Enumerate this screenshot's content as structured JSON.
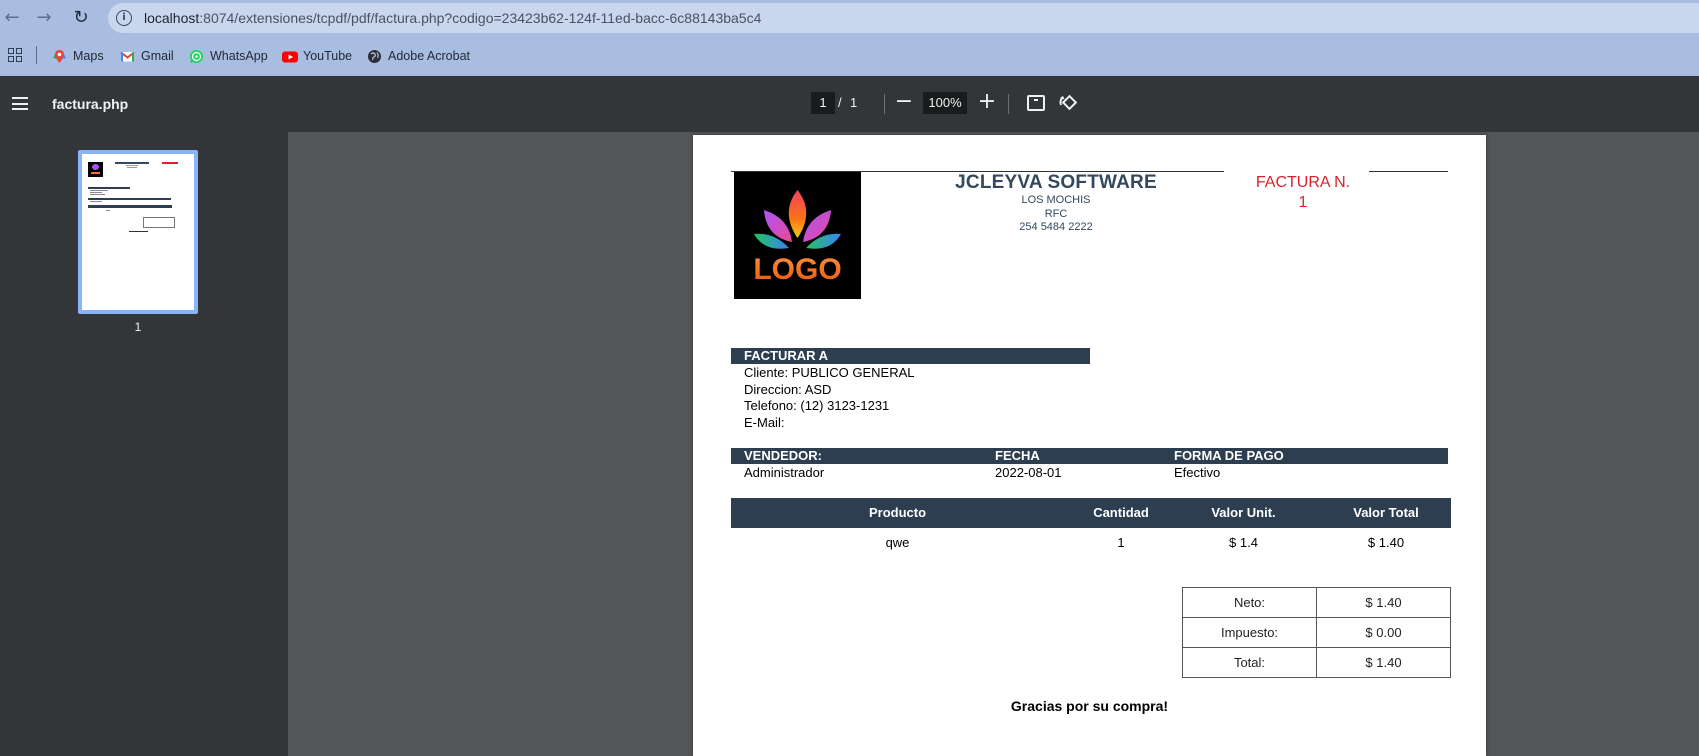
{
  "browser": {
    "url_host": "localhost",
    "url_path": ":8074/extensiones/tcpdf/pdf/factura.php?codigo=23423b62-124f-11ed-bacc-6c88143ba5c4",
    "bookmarks": [
      {
        "label": "Maps"
      },
      {
        "label": "Gmail"
      },
      {
        "label": "WhatsApp"
      },
      {
        "label": "YouTube"
      },
      {
        "label": "Adobe Acrobat"
      }
    ]
  },
  "viewer": {
    "title": "factura.php",
    "current_page": "1",
    "page_separator": "/",
    "total_pages": "1",
    "zoom": "100%",
    "thumbnail_label": "1"
  },
  "invoice": {
    "logo_text": "LOGO",
    "company_name": "JCLEYVA SOFTWARE",
    "company_city": "LOS MOCHIS",
    "company_rfc": "RFC",
    "company_phone": "254 5484 2222",
    "invoice_label": "FACTURA N.",
    "invoice_number": "1",
    "bill_to": {
      "header": "FACTURAR A",
      "client": "Cliente: PUBLICO GENERAL",
      "address": "Direccion: ASD",
      "phone": "Telefono: (12) 3123-1231",
      "email": "E-Mail:"
    },
    "sale": {
      "seller_header": "VENDEDOR:",
      "date_header": "FECHA",
      "payment_header": "FORMA DE PAGO",
      "seller": "Administrador",
      "date": "2022-08-01",
      "payment": "Efectivo"
    },
    "items_table": {
      "headers": [
        "Producto",
        "Cantidad",
        "Valor Unit.",
        "Valor Total"
      ],
      "rows": [
        [
          "qwe",
          "1",
          "$ 1.4",
          "$ 1.40"
        ]
      ]
    },
    "totals": [
      {
        "label": "Neto:",
        "value": "$ 1.40"
      },
      {
        "label": "Impuesto:",
        "value": "$ 0.00"
      },
      {
        "label": "Total:",
        "value": "$ 1.40"
      }
    ],
    "thanks": "Gracias por su compra!"
  },
  "colors": {
    "header_bar": "#2c3e50",
    "invoice_red": "#d9232e",
    "chrome_blue": "#a9bde0",
    "viewer_dark": "#323639"
  }
}
